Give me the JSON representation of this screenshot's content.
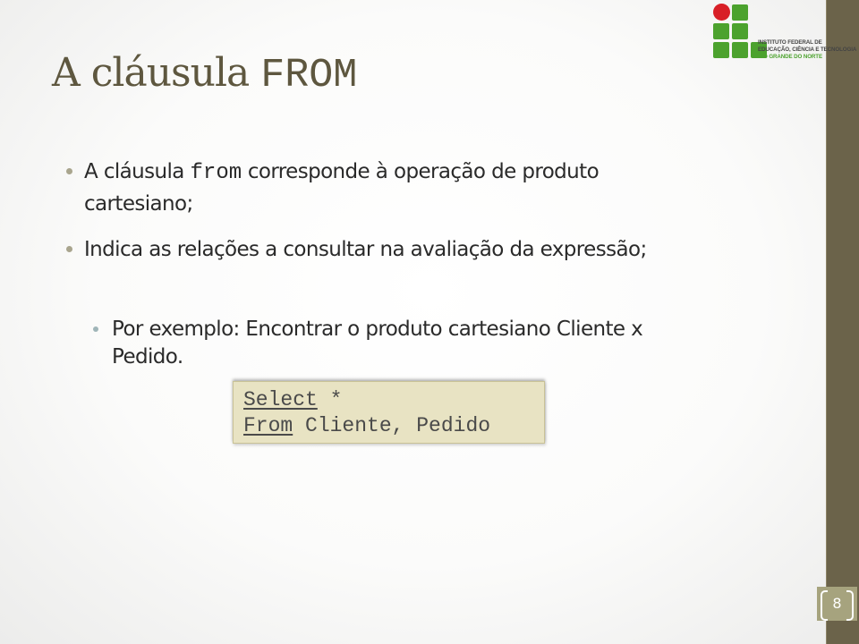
{
  "slide": {
    "title_text": "A cláusula ",
    "title_code": "FROM",
    "logo": {
      "line1": "INSTITUTO FEDERAL DE",
      "line2": "EDUCAÇÃO, CIÊNCIA E TECNOLOGIA",
      "line3": "RIO GRANDE DO NORTE",
      "colors": {
        "green": "#4ca22e",
        "red": "#d81f26"
      }
    },
    "bullets": [
      {
        "prefix": "A cláusula ",
        "code": "from",
        "suffix": " corresponde à operação de produto",
        "continuation": "cartesiano;"
      },
      {
        "text": "Indica as relações a consultar na avaliação da expressão;"
      }
    ],
    "sub_bullet": {
      "line1": "Por exemplo: Encontrar o produto cartesiano Cliente x",
      "line2": "Pedido."
    },
    "code_example": {
      "line1_keyword": "Select",
      "line1_rest": " *",
      "line2_keyword": "From",
      "line2_rest": " Cliente, Pedido"
    },
    "page_number": "8",
    "accent_color": "#6b634a"
  }
}
